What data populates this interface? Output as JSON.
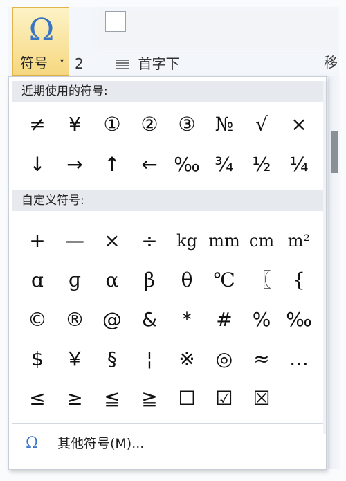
{
  "ribbon": {
    "symbol_button_label": "符号",
    "symbol_button_caret": "▾",
    "omega_icon": "Ω",
    "tail_partial_left": "2",
    "tail_partial_text": "首字下",
    "tail_partial_right": "移"
  },
  "panel": {
    "recent_header": "近期使用的符号:",
    "recent_symbols": [
      "≠",
      "¥",
      "①",
      "②",
      "③",
      "№",
      "√",
      "×",
      "↓",
      "→",
      "↑",
      "←",
      "‰",
      "¾",
      "½",
      "¼"
    ],
    "custom_header": "自定义符号:",
    "custom_symbols": [
      "+",
      "—",
      "×",
      "÷",
      "kg",
      "mm",
      "cm",
      "m²",
      "ɑ",
      "ɡ",
      "α",
      "β",
      "θ",
      "℃",
      "〖",
      "{",
      "©",
      "®",
      "@",
      "&",
      "*",
      "#",
      "%",
      "‰",
      "$",
      "￥",
      "§",
      "¦",
      "※",
      "◎",
      "≈",
      "…",
      "≤",
      "≥",
      "≦",
      "≧",
      "☐",
      "☑",
      "☒"
    ],
    "more_symbols_icon": "Ω",
    "more_symbols_label": "其他符号(M)..."
  },
  "colors": {
    "accent_blue": "#3a74c4",
    "header_bg": "#e6e9ee",
    "button_highlight": "#f6d77e"
  }
}
